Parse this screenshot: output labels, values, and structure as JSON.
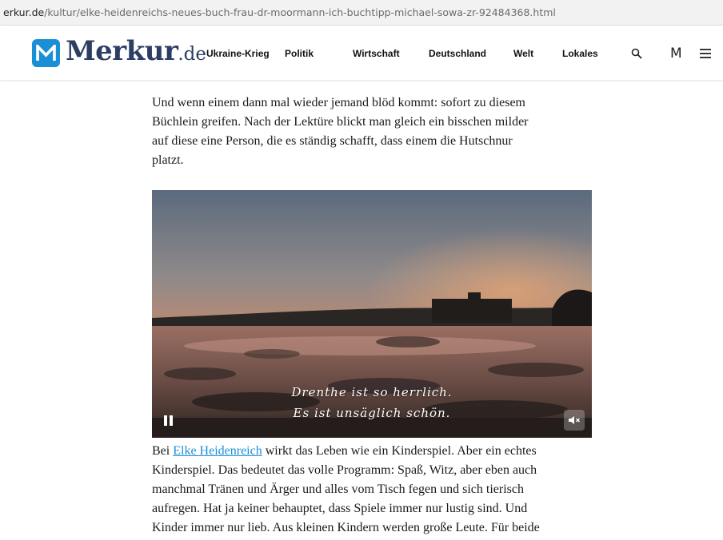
{
  "browser": {
    "url_domain": "erkur.de",
    "url_path": "/kultur/elke-heidenreichs-neues-buch-frau-dr-moormann-ich-buchtipp-michael-sowa-zr-92484368.html"
  },
  "header": {
    "logo_name": "Merkur",
    "logo_tld": ".de",
    "nav": [
      {
        "label": "Ukraine-Krieg"
      },
      {
        "label": "Politik"
      },
      {
        "label": "Wirtschaft"
      },
      {
        "label": "Deutschland"
      },
      {
        "label": "Welt"
      },
      {
        "label": "Lokales"
      }
    ],
    "account_letter": "M",
    "icons": [
      "search-icon",
      "account-icon",
      "menu-icon"
    ]
  },
  "article": {
    "paragraph_1_lines": [
      "Und wenn einem dann mal wieder jemand blöd kommt: sofort zu diesem",
      "Büchlein greifen. Nach der Lektüre blickt man gleich ein bisschen milder",
      "auf diese eine Person, die es ständig schafft, dass einem die Hutschnur",
      "platzt."
    ],
    "video": {
      "caption_line_1": "Drenthe ist so herrlich.",
      "caption_line_2": "Es ist unsäglich schön.",
      "controls": [
        "pause-icon",
        "mute-icon"
      ]
    },
    "paragraph_2_prefix": "Bei ",
    "paragraph_2_link": "Elke Heidenreich",
    "paragraph_2_line_1_rest": " wirkt das Leben wie ein Kinderspiel. Aber ein echtes",
    "paragraph_2_lines": [
      "Kinderspiel. Das bedeutet das volle Programm: Spaß, Witz, aber eben auch",
      "manchmal Tränen und Ärger und alles vom Tisch fegen und sich tierisch",
      "aufregen. Hat ja keiner behauptet, dass Spiele immer nur lustig sind. Und",
      "Kinder immer nur lieb. Aus kleinen Kindern werden große Leute. Für beide"
    ]
  },
  "colors": {
    "brand_blue": "#1a8fd6",
    "logo_navy": "#2c3e63",
    "link": "#1a8fd6"
  }
}
